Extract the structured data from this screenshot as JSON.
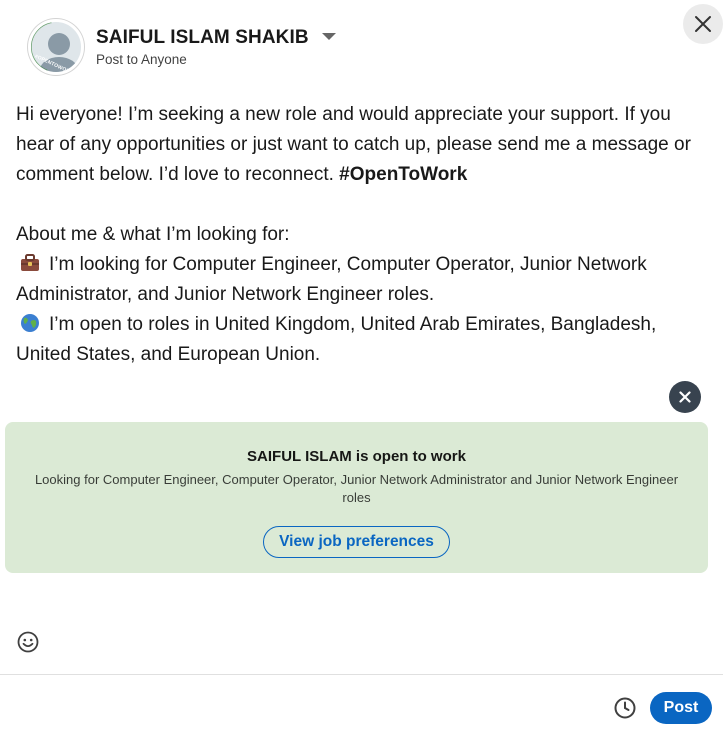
{
  "author": {
    "name": "SAIFUL ISLAM SHAKIB",
    "audience": "Post to Anyone",
    "badge": "#OPENTOWORK"
  },
  "post": {
    "intro": "Hi everyone! I’m seeking a new role and would appreciate your support. If you hear of any opportunities or just want to catch up, please send me a message or comment below. I’d love to reconnect. ",
    "hashtag": "#OpenToWork",
    "about_heading": "About me & what I’m looking for:",
    "roles_line": "I’m looking for Computer Engineer, Computer Operator, Junior Network Administrator, and Junior Network Engineer roles.",
    "locations_line": "I’m open to roles in United Kingdom, United Arab Emirates, Bangladesh, United States, and European Union."
  },
  "open_to_work_card": {
    "title": "SAIFUL ISLAM is open to work",
    "description": "Looking for Computer Engineer, Computer Operator, Junior Network Administrator and Junior Network Engineer roles",
    "button_label": "View job preferences",
    "background_color": "#dbead5"
  },
  "footer": {
    "post_label": "Post"
  },
  "icons": {
    "close": "close-icon",
    "remove_card": "remove-card-icon",
    "emoji": "smiley-icon",
    "schedule": "clock-icon",
    "roles": "briefcase-icon",
    "locations": "globe-icon"
  },
  "colors": {
    "accent": "#0a66c2",
    "card": "#dbead5"
  }
}
